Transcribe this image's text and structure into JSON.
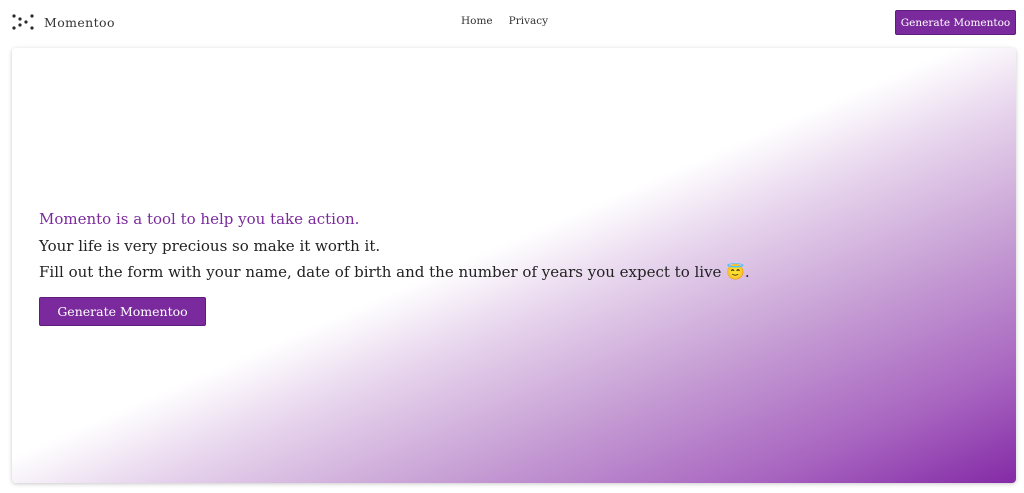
{
  "navbar": {
    "brand_name": "Momentoo",
    "brand_icon": "dots-pattern-icon",
    "links": [
      "Home",
      "Privacy"
    ],
    "cta_label": "Generate Momentoo"
  },
  "hero": {
    "tagline": "Momento is a tool to help you take action.",
    "line1": "Your life is very precious so make it worth it.",
    "line2": "Fill out the form with your name, date of birth and the number of years you expect to live 😇.",
    "cta_label": "Generate Momentoo"
  },
  "colors": {
    "brand": "#7b2a9e",
    "gradient_end": "#842aa6"
  }
}
